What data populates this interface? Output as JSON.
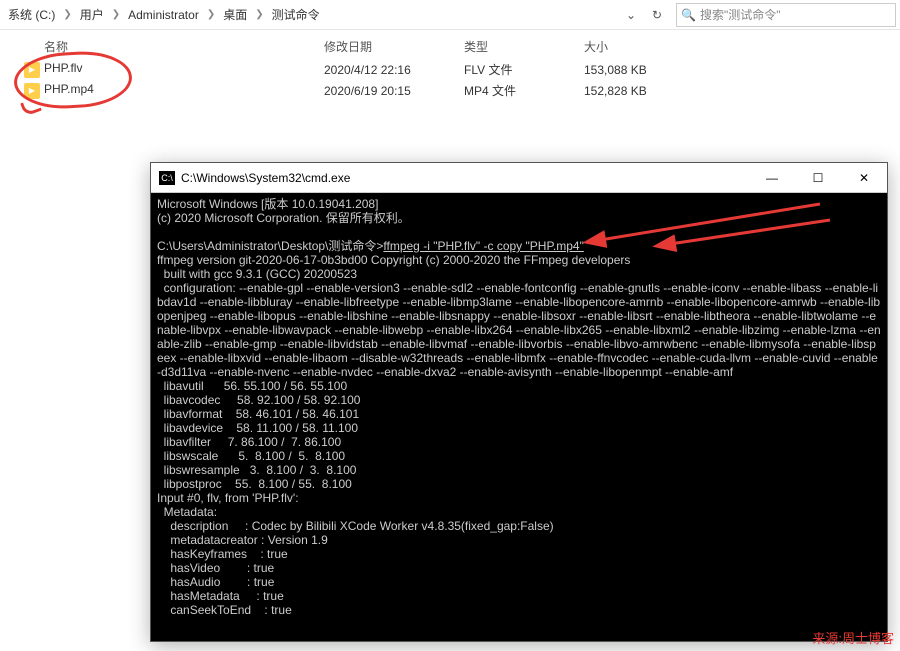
{
  "breadcrumb": {
    "items": [
      "系统 (C:)",
      "用户",
      "Administrator",
      "桌面",
      "测试命令"
    ]
  },
  "search": {
    "placeholder": "搜索\"测试命令\""
  },
  "columns": {
    "name": "名称",
    "date": "修改日期",
    "type": "类型",
    "size": "大小"
  },
  "files": [
    {
      "name": "PHP.flv",
      "date": "2020/4/12 22:16",
      "type": "FLV 文件",
      "size": "153,088 KB"
    },
    {
      "name": "PHP.mp4",
      "date": "2020/6/19 20:15",
      "type": "MP4 文件",
      "size": "152,828 KB"
    }
  ],
  "terminal": {
    "title": "C:\\Windows\\System32\\cmd.exe",
    "icon_label": "C:\\",
    "lines_pre": "Microsoft Windows [版本 10.0.19041.208]\n(c) 2020 Microsoft Corporation. 保留所有权利。\n\n",
    "prompt": "C:\\Users\\Administrator\\Desktop\\测试命令>",
    "command": "ffmpeg -i \"PHP.flv\" -c copy \"PHP.mp4\"",
    "lines_post": "ffmpeg version git-2020-06-17-0b3bd00 Copyright (c) 2000-2020 the FFmpeg developers\n  built with gcc 9.3.1 (GCC) 20200523\n  configuration: --enable-gpl --enable-version3 --enable-sdl2 --enable-fontconfig --enable-gnutls --enable-iconv --enable-libass --enable-libdav1d --enable-libbluray --enable-libfreetype --enable-libmp3lame --enable-libopencore-amrnb --enable-libopencore-amrwb --enable-libopenjpeg --enable-libopus --enable-libshine --enable-libsnappy --enable-libsoxr --enable-libsrt --enable-libtheora --enable-libtwolame --enable-libvpx --enable-libwavpack --enable-libwebp --enable-libx264 --enable-libx265 --enable-libxml2 --enable-libzimg --enable-lzma --enable-zlib --enable-gmp --enable-libvidstab --enable-libvmaf --enable-libvorbis --enable-libvo-amrwbenc --enable-libmysofa --enable-libspeex --enable-libxvid --enable-libaom --disable-w32threads --enable-libmfx --enable-ffnvcodec --enable-cuda-llvm --enable-cuvid --enable-d3d11va --enable-nvenc --enable-nvdec --enable-dxva2 --enable-avisynth --enable-libopenmpt --enable-amf\n  libavutil      56. 55.100 / 56. 55.100\n  libavcodec     58. 92.100 / 58. 92.100\n  libavformat    58. 46.101 / 58. 46.101\n  libavdevice    58. 11.100 / 58. 11.100\n  libavfilter     7. 86.100 /  7. 86.100\n  libswscale      5.  8.100 /  5.  8.100\n  libswresample   3.  8.100 /  3.  8.100\n  libpostproc    55.  8.100 / 55.  8.100\nInput #0, flv, from 'PHP.flv':\n  Metadata:\n    description     : Codec by Bilibili XCode Worker v4.8.35(fixed_gap:False)\n    metadatacreator : Version 1.9\n    hasKeyframes    : true\n    hasVideo        : true\n    hasAudio        : true\n    hasMetadata     : true\n    canSeekToEnd    : true"
  },
  "watermark": "来源:周士博客"
}
